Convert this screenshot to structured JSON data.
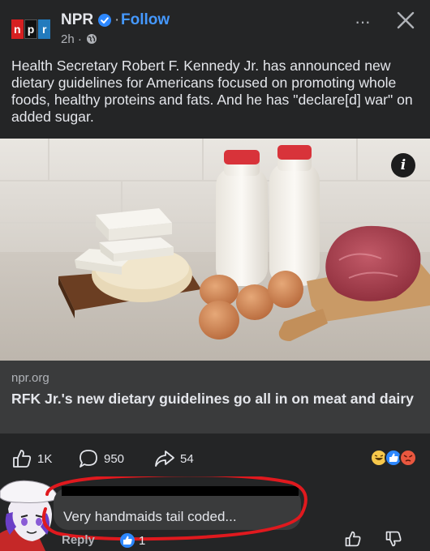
{
  "header": {
    "logo_letters": [
      "n",
      "p",
      "r"
    ],
    "page_name": "NPR",
    "separator": "·",
    "follow_label": "Follow",
    "timestamp": "2h ·",
    "more_label": "···"
  },
  "post": {
    "text": "Health Secretary Robert F. Kennedy Jr. has announced new dietary guidelines for Americans focused on promoting whole foods, healthy proteins and fats. And he has \"declare[d] war\" on added sugar."
  },
  "link_card": {
    "info_label": "i",
    "domain": "npr.org",
    "title": "RFK Jr.'s new dietary guidelines go all in on meat and dairy"
  },
  "actions": {
    "like_count": "1K",
    "comment_count": "950",
    "share_count": "54"
  },
  "comment": {
    "text": "Very handmaids tail coded...",
    "reply_label": "Reply",
    "like_count": "1"
  },
  "colors": {
    "background": "#242526",
    "card": "#3a3b3c",
    "link_blue": "#4599ff",
    "verified_blue": "#2d88ff",
    "scribble_red": "#e0191e"
  }
}
